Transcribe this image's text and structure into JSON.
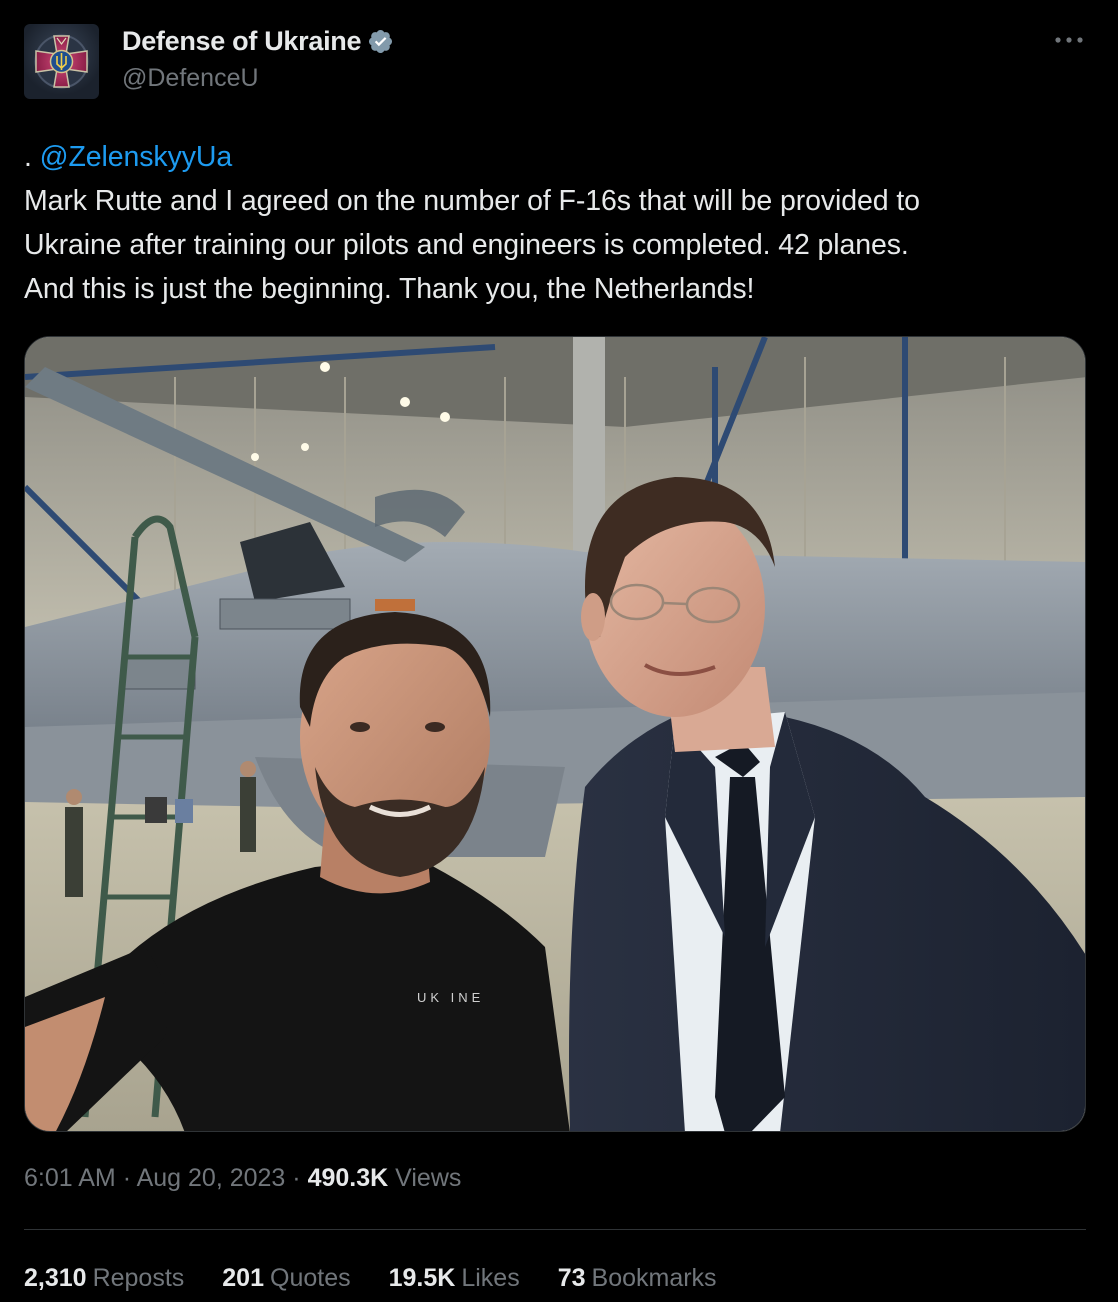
{
  "account": {
    "display_name": "Defense of Ukraine",
    "handle": "@DefenceU",
    "verified": true
  },
  "tweet": {
    "prefix": ".",
    "mention": "@ZelenskyyUa",
    "lines": [
      "Mark Rutte and I agreed on the number of F-16s that will be provided to",
      "Ukraine after training our pilots and engineers is completed. 42 planes.",
      "And this is just the beginning. Thank you, the Netherlands!"
    ]
  },
  "media": {
    "shirt_text": "UK  INE"
  },
  "meta": {
    "time": "6:01 AM",
    "separator": "·",
    "date": "Aug 20, 2023",
    "views_count": "490.3K",
    "views_label": "Views"
  },
  "stats": [
    {
      "count": "2,310",
      "label": "Reposts"
    },
    {
      "count": "201",
      "label": "Quotes"
    },
    {
      "count": "19.5K",
      "label": "Likes"
    },
    {
      "count": "73",
      "label": "Bookmarks"
    }
  ],
  "colors": {
    "background": "#000000",
    "text": "#e7e9ea",
    "secondary": "#71767b",
    "link": "#1d9bf0",
    "divider": "#2f3336"
  }
}
